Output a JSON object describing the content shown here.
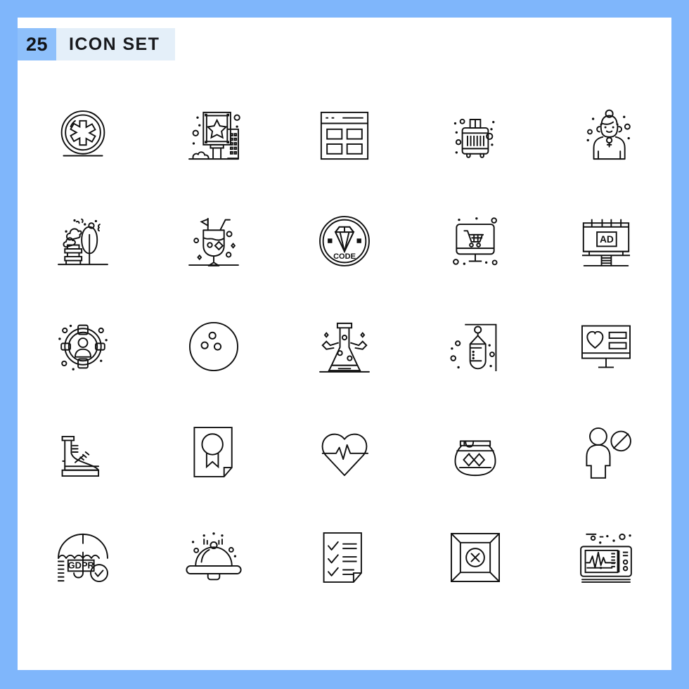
{
  "header": {
    "count_badge": "25",
    "title": "ICON SET",
    "badge_bg": "#8ec0fb",
    "title_bg": "#e4eff9",
    "text_color": "#18191d"
  },
  "frame": {
    "border_color": "#7fb6fb",
    "card_bg": "#ffffff",
    "stroke_color": "#111111"
  },
  "grid": {
    "rows": 5,
    "columns": 5,
    "total_icons": 25
  },
  "icons": [
    {
      "index": 1,
      "name": "medical-star-of-life-icon",
      "label": "Medical",
      "inline_text": ""
    },
    {
      "index": 2,
      "name": "billboard-star-icon",
      "label": "Billboard",
      "inline_text": ""
    },
    {
      "index": 3,
      "name": "browser-grid-layout-icon",
      "label": "Layout",
      "inline_text": ""
    },
    {
      "index": 4,
      "name": "luggage-suitcase-icon",
      "label": "Luggage",
      "inline_text": ""
    },
    {
      "index": 5,
      "name": "woman-avatar-icon",
      "label": "Woman",
      "inline_text": ""
    },
    {
      "index": 6,
      "name": "park-bench-tree-icon",
      "label": "Park",
      "inline_text": ""
    },
    {
      "index": 7,
      "name": "cocktail-drink-icon",
      "label": "Cocktail",
      "inline_text": ""
    },
    {
      "index": 8,
      "name": "code-diamond-badge-icon",
      "label": "Code",
      "inline_text": "CODE"
    },
    {
      "index": 9,
      "name": "online-shopping-monitor-icon",
      "label": "Online Shopping",
      "inline_text": ""
    },
    {
      "index": 10,
      "name": "ad-billboard-icon",
      "label": "Advertisement",
      "inline_text": "AD"
    },
    {
      "index": 11,
      "name": "target-audience-icon",
      "label": "Target Audience",
      "inline_text": ""
    },
    {
      "index": 12,
      "name": "bowling-ball-icon",
      "label": "Bowling",
      "inline_text": ""
    },
    {
      "index": 13,
      "name": "chemistry-flask-icon",
      "label": "Chemistry",
      "inline_text": ""
    },
    {
      "index": 14,
      "name": "punching-bag-icon",
      "label": "Punching Bag",
      "inline_text": ""
    },
    {
      "index": 15,
      "name": "monitor-heart-favorite-icon",
      "label": "Favorites",
      "inline_text": ""
    },
    {
      "index": 16,
      "name": "boot-shoe-icon",
      "label": "Boot",
      "inline_text": ""
    },
    {
      "index": 17,
      "name": "certificate-ribbon-icon",
      "label": "Certificate",
      "inline_text": ""
    },
    {
      "index": 18,
      "name": "heartbeat-pulse-icon",
      "label": "Heartbeat",
      "inline_text": ""
    },
    {
      "index": 19,
      "name": "jam-honey-jar-icon",
      "label": "Jam Jar",
      "inline_text": ""
    },
    {
      "index": 20,
      "name": "person-blocked-icon",
      "label": "Blocked",
      "inline_text": ""
    },
    {
      "index": 21,
      "name": "gdpr-umbrella-icon",
      "label": "GDPR",
      "inline_text": "GDPR"
    },
    {
      "index": 22,
      "name": "food-cloche-platter-icon",
      "label": "Food Cover",
      "inline_text": ""
    },
    {
      "index": 23,
      "name": "checklist-document-icon",
      "label": "Checklist",
      "inline_text": ""
    },
    {
      "index": 24,
      "name": "box-cancel-icon",
      "label": "Cancelled Box",
      "inline_text": ""
    },
    {
      "index": 25,
      "name": "ecg-monitor-icon",
      "label": "ECG Monitor",
      "inline_text": ""
    }
  ]
}
